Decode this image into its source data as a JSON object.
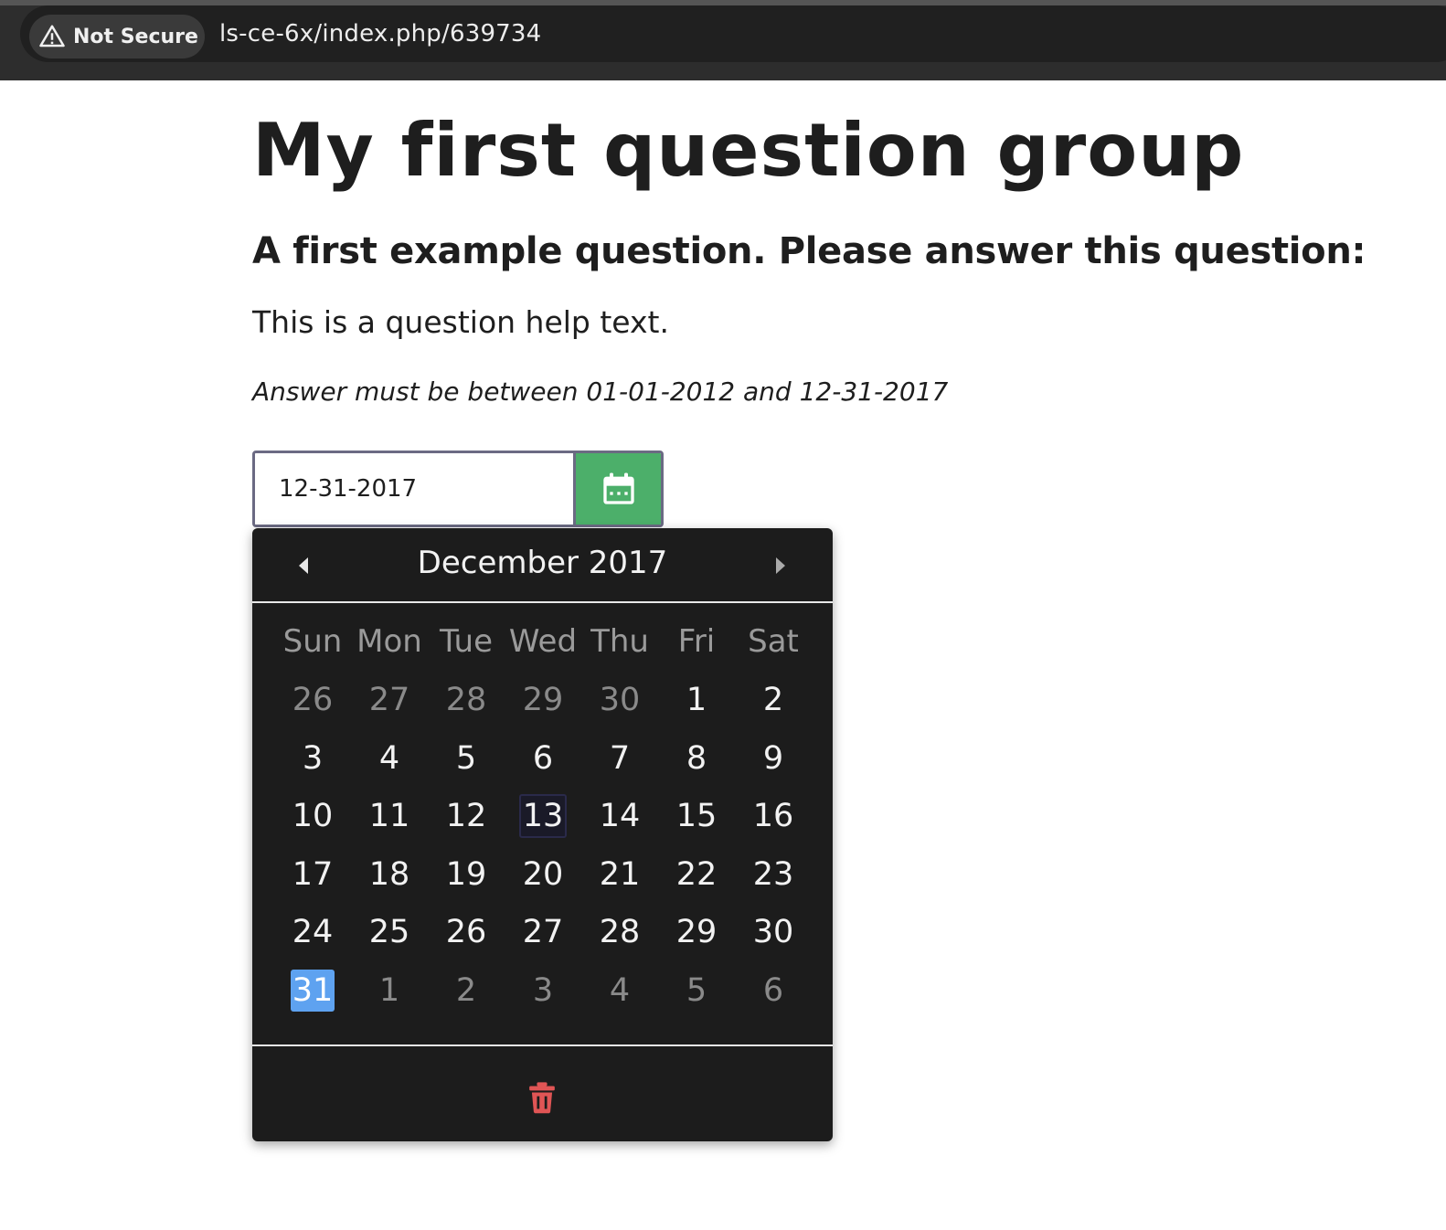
{
  "browser": {
    "security_label": "Not Secure",
    "url": "ls-ce-6x/index.php/639734"
  },
  "survey": {
    "group_title": "My first question group",
    "question": "A first example question. Please answer this question:",
    "help_text": "This is a question help text.",
    "validation_tip": "Answer must be between 01-01-2012 and 12-31-2017"
  },
  "date_field": {
    "value": "12-31-2017",
    "button_icon": "calendar-icon"
  },
  "datepicker": {
    "month_label": "December 2017",
    "weekdays": [
      "Sun",
      "Mon",
      "Tue",
      "Wed",
      "Thu",
      "Fri",
      "Sat"
    ],
    "weeks": [
      [
        {
          "d": "26",
          "muted": true
        },
        {
          "d": "27",
          "muted": true
        },
        {
          "d": "28",
          "muted": true
        },
        {
          "d": "29",
          "muted": true
        },
        {
          "d": "30",
          "muted": true
        },
        {
          "d": "1"
        },
        {
          "d": "2"
        }
      ],
      [
        {
          "d": "3"
        },
        {
          "d": "4"
        },
        {
          "d": "5"
        },
        {
          "d": "6"
        },
        {
          "d": "7"
        },
        {
          "d": "8"
        },
        {
          "d": "9"
        }
      ],
      [
        {
          "d": "10"
        },
        {
          "d": "11"
        },
        {
          "d": "12"
        },
        {
          "d": "13",
          "today": true
        },
        {
          "d": "14"
        },
        {
          "d": "15"
        },
        {
          "d": "16"
        }
      ],
      [
        {
          "d": "17"
        },
        {
          "d": "18"
        },
        {
          "d": "19"
        },
        {
          "d": "20"
        },
        {
          "d": "21"
        },
        {
          "d": "22"
        },
        {
          "d": "23"
        }
      ],
      [
        {
          "d": "24"
        },
        {
          "d": "25"
        },
        {
          "d": "26"
        },
        {
          "d": "27"
        },
        {
          "d": "28"
        },
        {
          "d": "29"
        },
        {
          "d": "30"
        }
      ],
      [
        {
          "d": "31",
          "selected": true
        },
        {
          "d": "1",
          "muted": true
        },
        {
          "d": "2",
          "muted": true
        },
        {
          "d": "3",
          "muted": true
        },
        {
          "d": "4",
          "muted": true
        },
        {
          "d": "5",
          "muted": true
        },
        {
          "d": "6",
          "muted": true
        }
      ]
    ],
    "clear_icon": "trash-icon"
  },
  "colors": {
    "calendar_button": "#4caf6a",
    "selected_day": "#5ea2f0",
    "trash": "#e05555"
  }
}
